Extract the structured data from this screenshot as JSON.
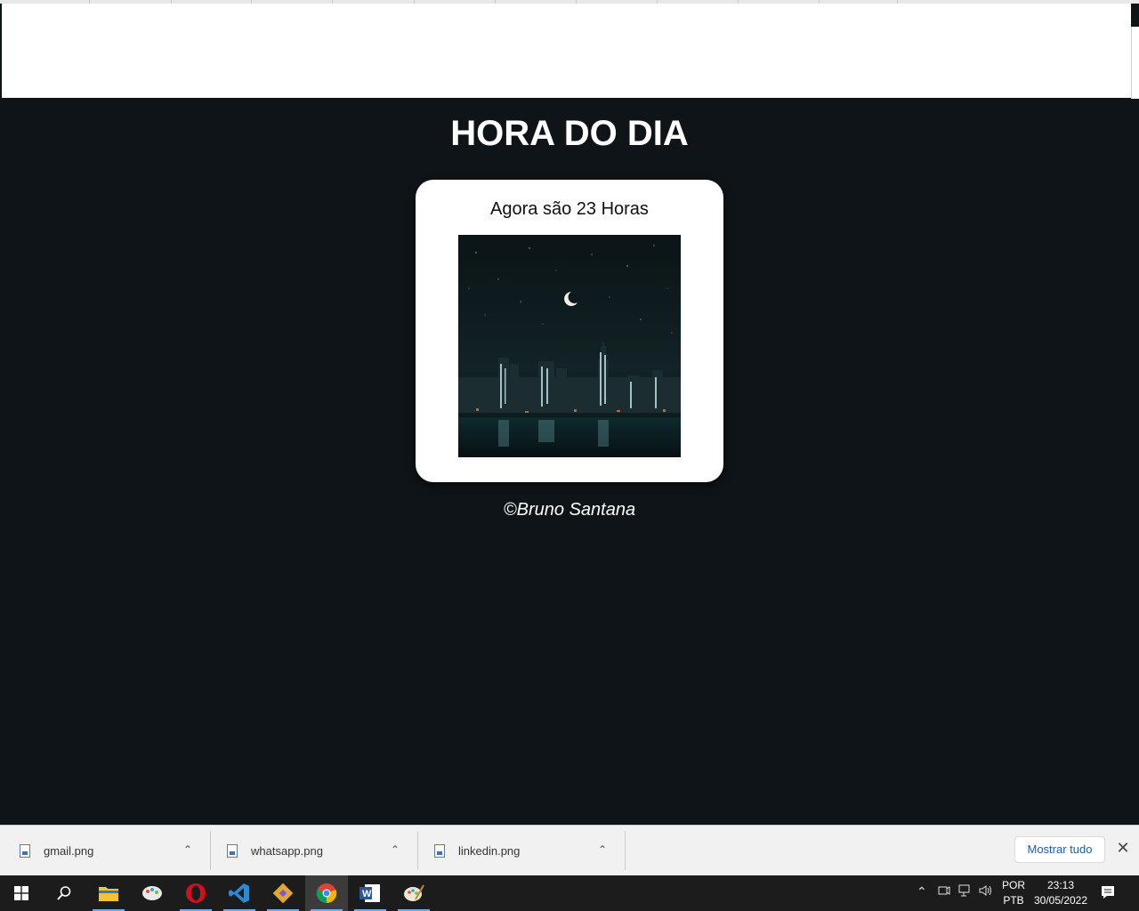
{
  "page": {
    "title": "HORA DO DIA",
    "message": "Agora são 23 Horas",
    "credit": "©Bruno Santana"
  },
  "downloads": {
    "items": [
      {
        "name": "gmail.png"
      },
      {
        "name": "whatsapp.png"
      },
      {
        "name": "linkedin.png"
      }
    ],
    "show_all": "Mostrar tudo"
  },
  "taskbar": {
    "apps": [
      "windows-start",
      "search",
      "file-explorer",
      "paint-3d",
      "opera",
      "vs-code",
      "git",
      "chrome",
      "word",
      "paint"
    ],
    "lang_line1": "POR",
    "lang_line2": "PTB",
    "time": "23:13",
    "date": "30/05/2022"
  },
  "colors": {
    "background": "#0e1417",
    "card": "#ffffff",
    "taskbar": "#1c1c1c"
  }
}
